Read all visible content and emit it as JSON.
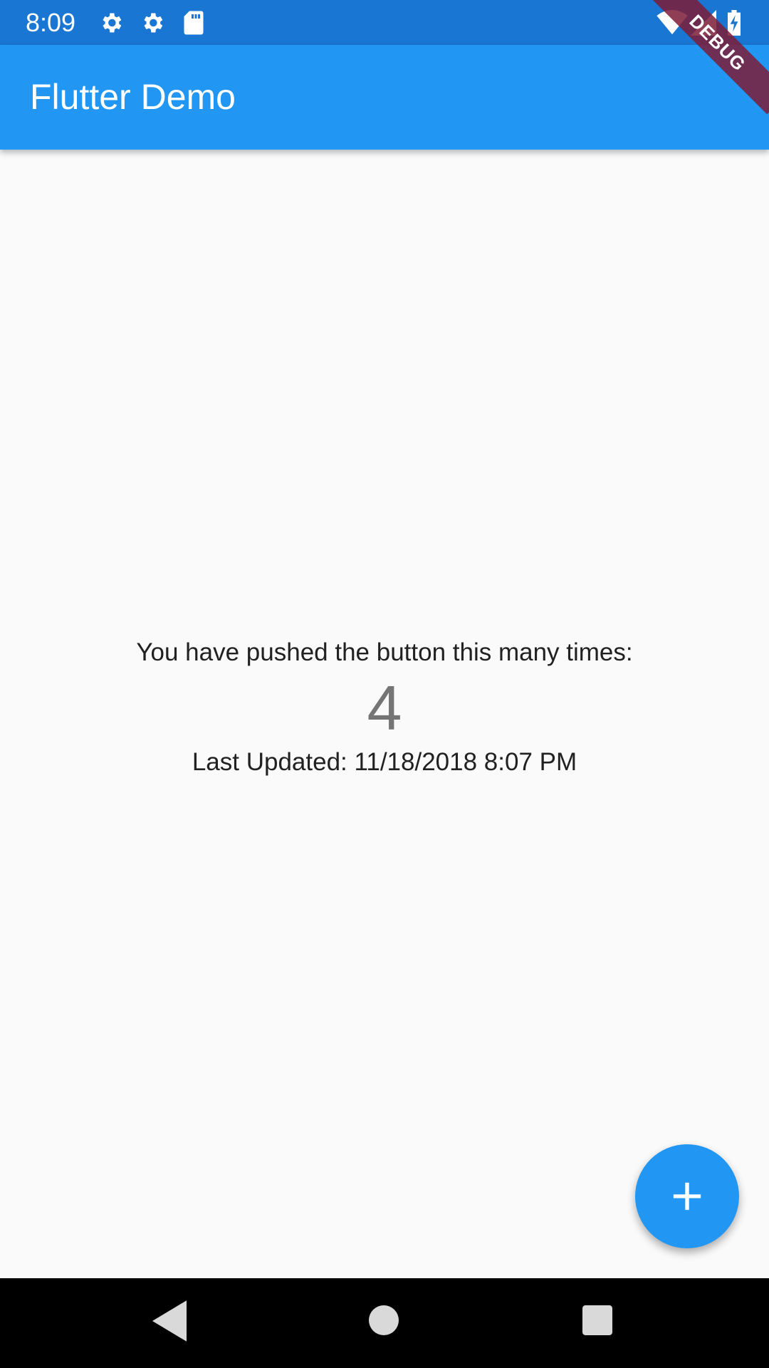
{
  "status_bar": {
    "time": "8:09",
    "left_icons": [
      "gear-icon",
      "gear-icon",
      "sd-card-icon"
    ],
    "right_icons": [
      "wifi-icon",
      "cell-signal-icon",
      "battery-charging-icon"
    ]
  },
  "app_bar": {
    "title": "Flutter Demo",
    "debug_banner": "DEBUG"
  },
  "body": {
    "counter_label": "You have pushed the button this many times:",
    "counter_value": "4",
    "last_updated": "Last Updated: 11/18/2018 8:07 PM"
  },
  "fab": {
    "icon": "plus-icon"
  },
  "nav_bar": {
    "icons": [
      "back-icon",
      "home-icon",
      "recents-icon"
    ]
  },
  "colors": {
    "status_bar": "#1976d2",
    "app_bar": "#2196f3",
    "background": "#fafafa",
    "fab": "#2196f3",
    "nav_bar": "#000000",
    "debug_banner": "#7d1c37"
  }
}
